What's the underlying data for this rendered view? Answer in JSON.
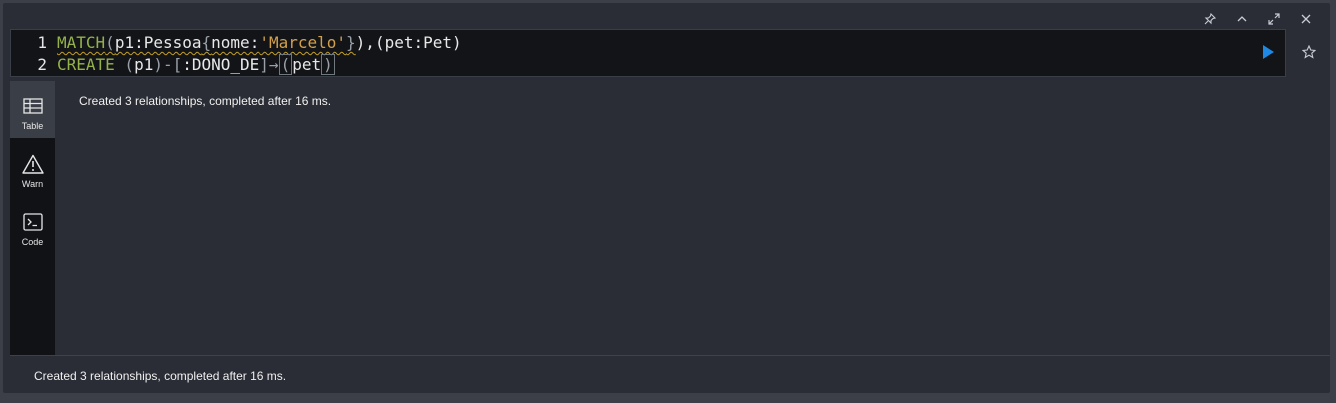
{
  "window_actions": [
    {
      "name": "pin-icon"
    },
    {
      "name": "collapse-icon"
    },
    {
      "name": "fullscreen-icon"
    },
    {
      "name": "close-icon"
    }
  ],
  "editor": {
    "line1_number": "1",
    "line2_number": "2",
    "line1": {
      "kw": "MATCH",
      "p1": "(",
      "t1": "p1:Pessoa",
      "p2": "{",
      "t2": "nome:",
      "s1": "'Marcelo'",
      "p3": "}",
      "t3": "),(pet:Pet)"
    },
    "line2": {
      "kw": "CREATE",
      "p1": " (",
      "t1": "p1",
      "p2": ")-[",
      "t2": ":DONO_DE",
      "p3": "]→",
      "p4": "(",
      "t3": "pet",
      "p5": ")"
    }
  },
  "run_icon": "play-icon",
  "favorite_icon": "star-icon",
  "sidebar": {
    "items": [
      {
        "label": "Table",
        "icon": "table-icon",
        "active": true
      },
      {
        "label": "Warn",
        "icon": "warning-icon",
        "active": false
      },
      {
        "label": "Code",
        "icon": "terminal-icon",
        "active": false
      }
    ]
  },
  "result": {
    "message": "Created 3 relationships, completed after 16 ms."
  },
  "footer": {
    "status": "Created 3 relationships, completed after 16 ms."
  },
  "colors": {
    "accent_play": "#1e88e5",
    "keyword": "#95b24a",
    "string": "#d2a04a"
  }
}
